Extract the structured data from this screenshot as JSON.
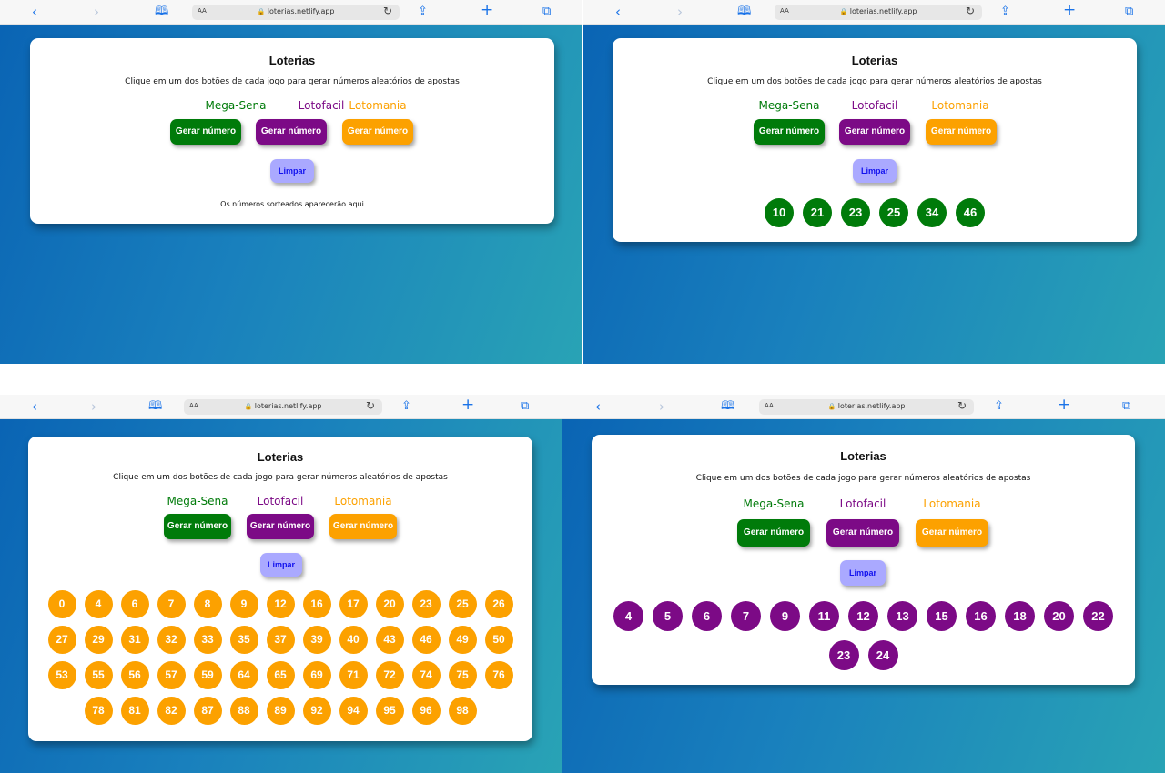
{
  "browser": {
    "url": "loterias.netlify.app",
    "text_size_label": "AA",
    "back_glyph": "‹",
    "forward_glyph": "›",
    "bookmarks_glyph": "🕮",
    "share_glyph": "⇪",
    "new_tab_glyph": "+",
    "tabs_glyph": "⧉",
    "reload_glyph": "↻",
    "lock_glyph": "🔒"
  },
  "app": {
    "title": "Loterias",
    "subtitle": "Clique em um dos botões de cada jogo para gerar números aleatórios de apostas",
    "games": [
      {
        "name": "Mega-Sena",
        "color": "#007b0a",
        "button_label": "Gerar número"
      },
      {
        "name": "Lotofacil",
        "color": "#7c0a86",
        "button_label": "Gerar número"
      },
      {
        "name": "Lotomania",
        "color": "#fca100",
        "button_label": "Gerar número"
      }
    ],
    "clear_label": "Limpar",
    "clear_color": "#aaa9ff",
    "placeholder": "Os números sorteados aparecerão aqui"
  },
  "screens": [
    {
      "state": "initial",
      "numbers": []
    },
    {
      "state": "mega-sena",
      "numbers": [
        "10",
        "21",
        "23",
        "25",
        "34",
        "46"
      ]
    },
    {
      "state": "lotomania",
      "numbers": [
        "0",
        "4",
        "6",
        "7",
        "8",
        "9",
        "12",
        "16",
        "17",
        "20",
        "23",
        "25",
        "26",
        "27",
        "29",
        "31",
        "32",
        "33",
        "35",
        "37",
        "39",
        "40",
        "43",
        "46",
        "49",
        "50",
        "53",
        "55",
        "56",
        "57",
        "59",
        "64",
        "65",
        "69",
        "71",
        "72",
        "74",
        "75",
        "76",
        "78",
        "81",
        "82",
        "87",
        "88",
        "89",
        "92",
        "94",
        "95",
        "96",
        "98"
      ]
    },
    {
      "state": "lotofacil",
      "numbers": [
        "4",
        "5",
        "6",
        "7",
        "9",
        "11",
        "12",
        "13",
        "15",
        "16",
        "18",
        "20",
        "22",
        "23",
        "24"
      ]
    }
  ]
}
